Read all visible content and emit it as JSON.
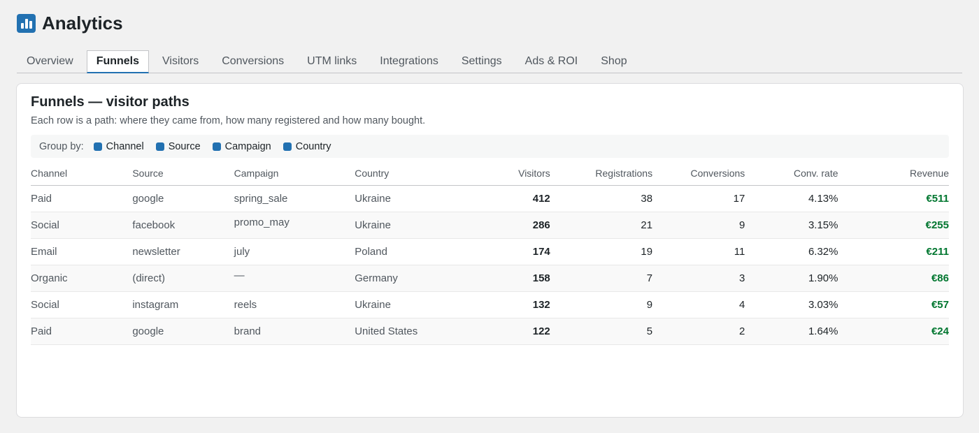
{
  "app": {
    "title": "Analytics",
    "logo_icon": "bar-chart-icon",
    "accent_color": "#2271b1"
  },
  "tabs": [
    {
      "label": "Overview",
      "active": false
    },
    {
      "label": "Funnels",
      "active": true
    },
    {
      "label": "Visitors",
      "active": false
    },
    {
      "label": "Conversions",
      "active": false
    },
    {
      "label": "UTM links",
      "active": false
    },
    {
      "label": "Integrations",
      "active": false
    },
    {
      "label": "Settings",
      "active": false
    },
    {
      "label": "Ads & ROI",
      "active": false
    },
    {
      "label": "Shop",
      "active": false
    }
  ],
  "card": {
    "title": "Funnels — visitor paths",
    "subtitle": "Each row is a path: where they came from, how many registered and how many bought."
  },
  "group_by": {
    "label": "Group by:",
    "options": [
      {
        "label": "Channel",
        "checked": true
      },
      {
        "label": "Source",
        "checked": true
      },
      {
        "label": "Campaign",
        "checked": true
      },
      {
        "label": "Country",
        "checked": true
      }
    ]
  },
  "table": {
    "columns": [
      "Channel",
      "Source",
      "Campaign",
      "Country",
      "Visitors",
      "Registrations",
      "Conversions",
      "Conv. rate",
      "Revenue"
    ],
    "rows": [
      {
        "channel": "Paid",
        "source": "google",
        "campaign": "spring_sale",
        "country": "Ukraine",
        "visitors": "412",
        "registrations": "38",
        "conversions": "17",
        "conv_rate": "4.13%",
        "revenue": "€511"
      },
      {
        "channel": "Social",
        "source": "facebook",
        "campaign": "promo_may",
        "country": "Ukraine",
        "visitors": "286",
        "registrations": "21",
        "conversions": "9",
        "conv_rate": "3.15%",
        "revenue": "€255"
      },
      {
        "channel": "Email",
        "source": "newsletter",
        "campaign": "july",
        "country": "Poland",
        "visitors": "174",
        "registrations": "19",
        "conversions": "11",
        "conv_rate": "6.32%",
        "revenue": "€211"
      },
      {
        "channel": "Organic",
        "source": "(direct)",
        "campaign": "—",
        "country": "Germany",
        "visitors": "158",
        "registrations": "7",
        "conversions": "3",
        "conv_rate": "1.90%",
        "revenue": "€86"
      },
      {
        "channel": "Social",
        "source": "instagram",
        "campaign": "reels",
        "country": "Ukraine",
        "visitors": "132",
        "registrations": "9",
        "conversions": "4",
        "conv_rate": "3.03%",
        "revenue": "€57"
      },
      {
        "channel": "Paid",
        "source": "google",
        "campaign": "brand",
        "country": "United States",
        "visitors": "122",
        "registrations": "5",
        "conversions": "2",
        "conv_rate": "1.64%",
        "revenue": "€24"
      }
    ]
  },
  "colors": {
    "link": "#2271b1",
    "revenue": "#00762f",
    "text": "#1d2327",
    "muted": "#50575e"
  }
}
